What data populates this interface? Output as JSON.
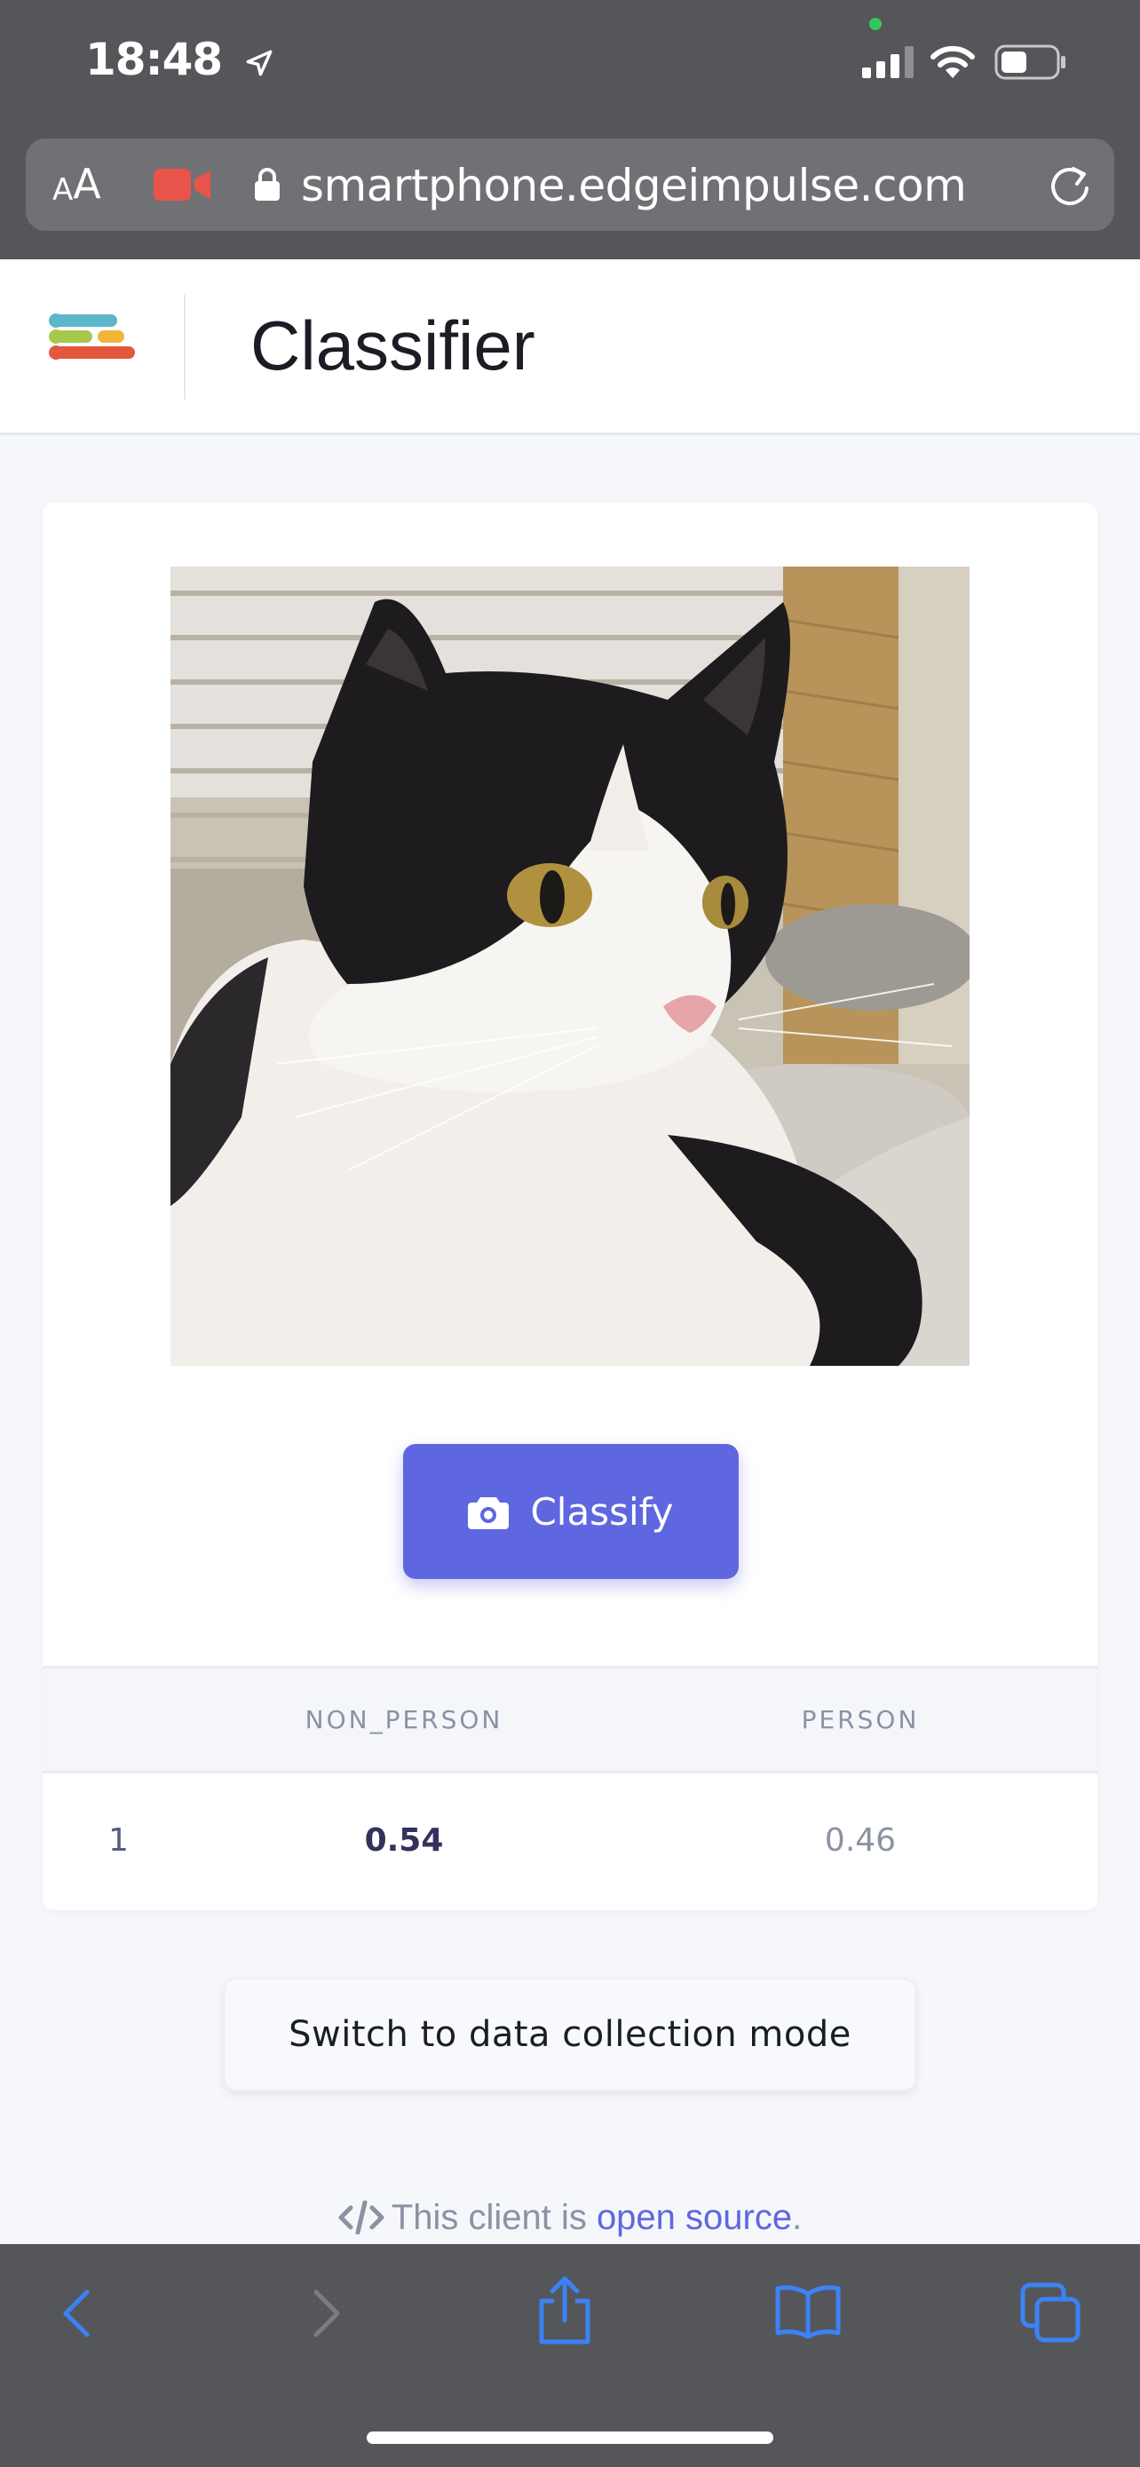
{
  "status_bar": {
    "time": "18:48"
  },
  "browser": {
    "aa_small": "A",
    "aa_big": "A",
    "url": "smartphone.edgeimpulse.com"
  },
  "header": {
    "title": "Classifier"
  },
  "classifier": {
    "classify_label": "Classify",
    "table": {
      "headers": [
        "",
        "NON_PERSON",
        "PERSON"
      ],
      "rows": [
        {
          "index": "1",
          "non_person": "0.54",
          "person": "0.46"
        }
      ]
    }
  },
  "switch_button_label": "Switch to data collection mode",
  "footer": {
    "prefix": "This client is ",
    "link_text": "open source",
    "suffix": "."
  },
  "colors": {
    "accent": "#5f67e0",
    "chrome": "#555659",
    "record": "#e9544a",
    "logo_blue": "#5bb7c9",
    "logo_green": "#a7c94b",
    "logo_yellow": "#f2b53a",
    "logo_orange": "#e3583d"
  },
  "icons": {
    "location": "location-arrow-icon",
    "signal": "cellular-signal-icon",
    "wifi": "wifi-icon",
    "battery": "battery-icon",
    "camera_record": "video-camera-icon",
    "lock": "lock-icon",
    "reload": "reload-icon",
    "classify": "camera-icon",
    "code": "code-icon",
    "back": "back-chevron-icon",
    "forward": "forward-chevron-icon",
    "share": "share-icon",
    "bookmarks": "book-icon",
    "tabs": "tabs-icon"
  }
}
